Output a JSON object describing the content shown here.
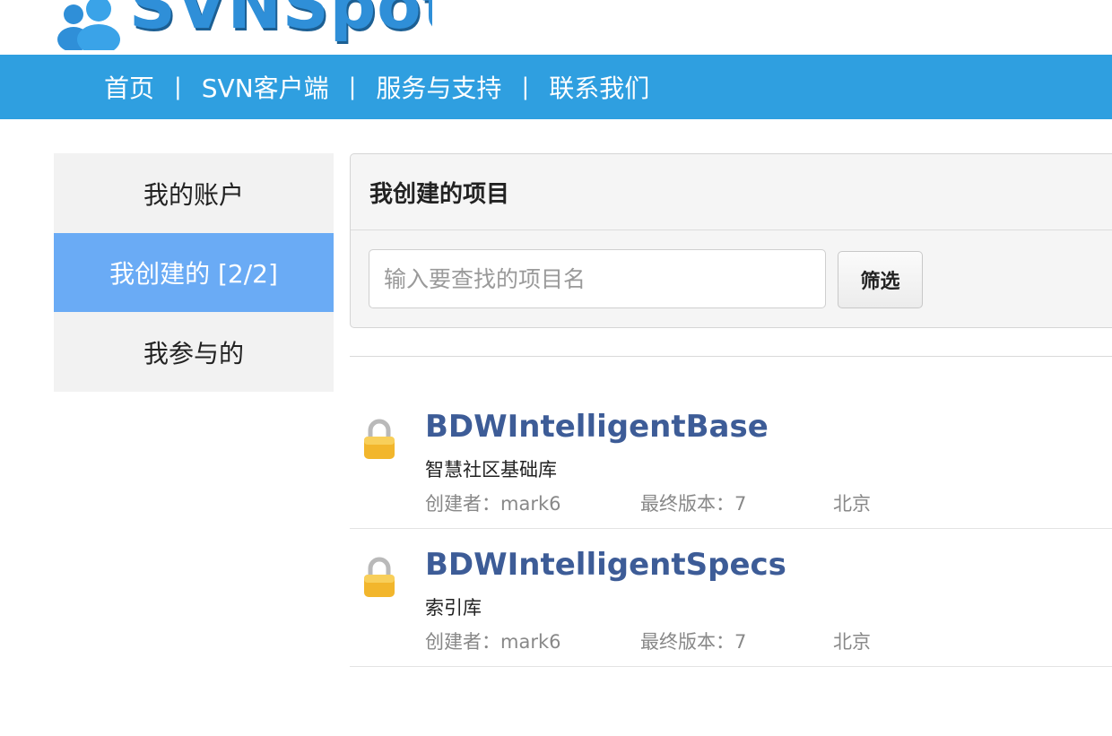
{
  "header": {
    "logo_text": "SVNSpot"
  },
  "nav": {
    "items": [
      "首页",
      "SVN客户端",
      "服务与支持",
      "联系我们"
    ],
    "separator": "|"
  },
  "sidebar": {
    "items": [
      {
        "label": "我的账户",
        "active": false
      },
      {
        "label": "我创建的 [2/2]",
        "active": true
      },
      {
        "label": "我参与的",
        "active": false
      }
    ]
  },
  "main": {
    "title": "我创建的项目",
    "search": {
      "placeholder": "输入要查找的项目名",
      "value": ""
    },
    "filter_label": "筛选"
  },
  "projects": [
    {
      "name": "BDWIntelligentBase",
      "description": "智慧社区基础库",
      "creator": "创建者：mark6",
      "version": "最终版本：7",
      "location": "北京"
    },
    {
      "name": "BDWIntelligentSpecs",
      "description": "索引库",
      "creator": "创建者：mark6",
      "version": "最终版本：7",
      "location": "北京"
    }
  ],
  "colors": {
    "navbar": "#2f9fe0",
    "sidebar_active": "#6aabf5",
    "project_link": "#3d5c97",
    "lock": "#f2b62c"
  }
}
